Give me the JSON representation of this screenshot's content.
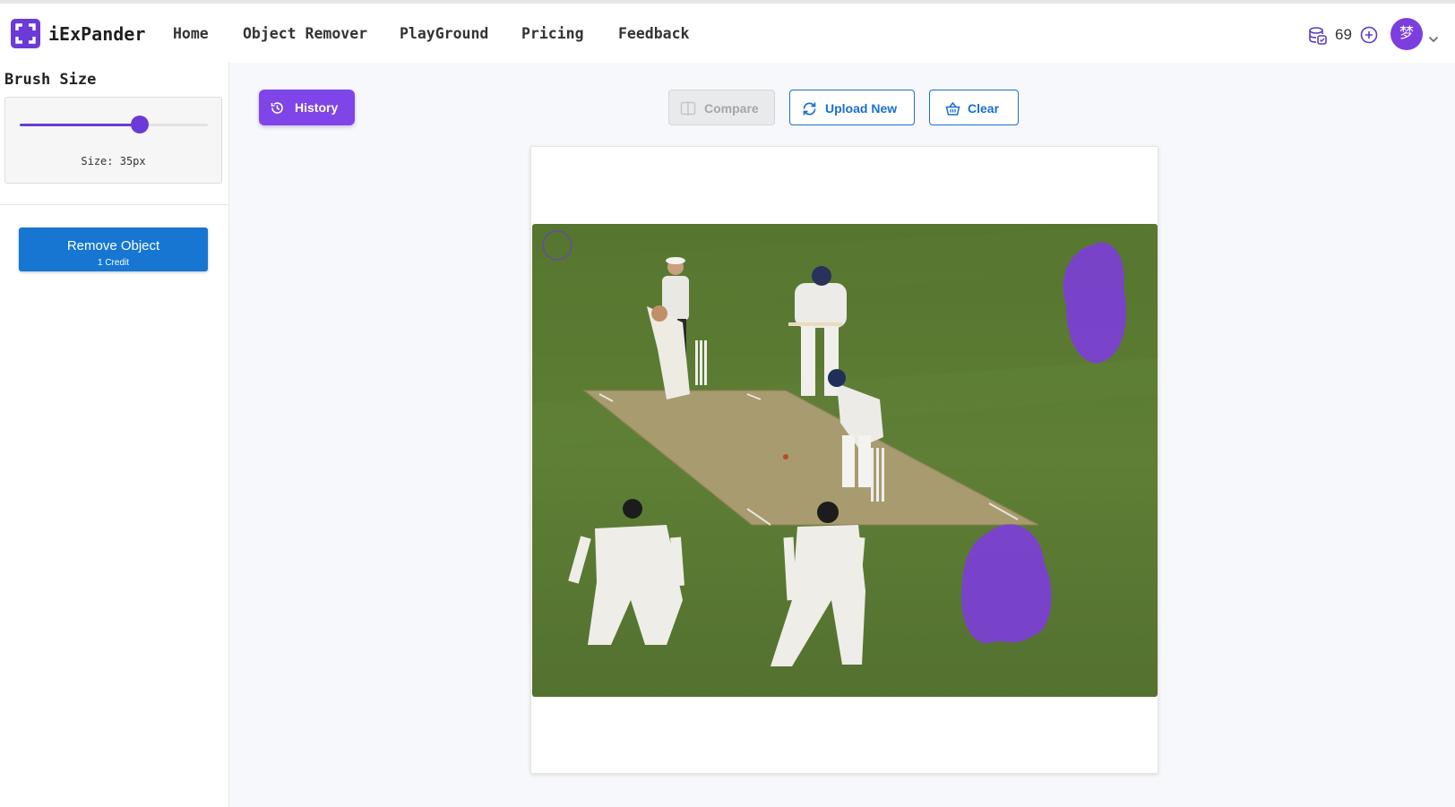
{
  "brand": {
    "name": "iExPander",
    "logo_icon": "expand-corners-icon"
  },
  "nav": [
    {
      "label": "Home"
    },
    {
      "label": "Object Remover"
    },
    {
      "label": "PlayGround"
    },
    {
      "label": "Pricing"
    },
    {
      "label": "Feedback"
    }
  ],
  "account": {
    "credits": "69",
    "avatar_initial": "梦",
    "avatar_color": "#7d3ee0"
  },
  "sidebar": {
    "brush_title": "Brush Size",
    "brush_size_value": 35,
    "brush_size_fraction": 0.64,
    "size_label": "Size: 35px",
    "remove_button": {
      "label": "Remove Object",
      "sublabel": "1 Credit"
    }
  },
  "toolbar": {
    "history_label": "History",
    "compare_label": "Compare",
    "upload_label": "Upload New",
    "clear_label": "Clear"
  },
  "colors": {
    "accent": "#6a3bd6",
    "primary_blue": "#1676d2",
    "mask_purple": "#7c3fd6",
    "field_green": "#5b7d35"
  }
}
